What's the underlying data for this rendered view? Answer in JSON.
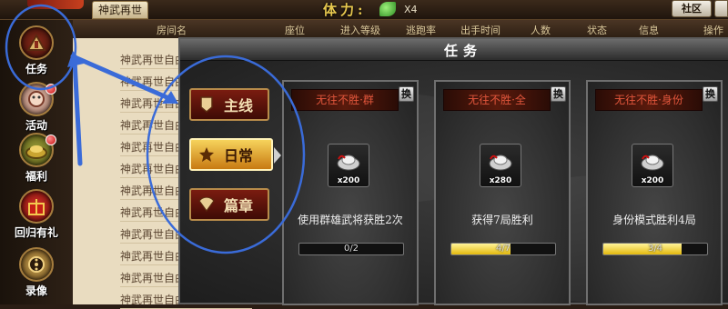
{
  "topbar": {
    "room_tab": "神武再世",
    "stamina_label": "体力:",
    "stamina_count": "X4",
    "community": "社区"
  },
  "sidebar": {
    "items": [
      {
        "label": "任务",
        "icon": "task-icon",
        "badge": false
      },
      {
        "label": "活动",
        "icon": "activity-icon",
        "badge": true
      },
      {
        "label": "福利",
        "icon": "welfare-icon",
        "badge": true
      },
      {
        "label": "回归有礼",
        "icon": "gift-icon",
        "badge": false
      },
      {
        "label": "录像",
        "icon": "replay-icon",
        "badge": false
      }
    ]
  },
  "room_list": {
    "columns": [
      "房间名",
      "座位",
      "进入等级",
      "逃跑率",
      "出手时间",
      "人数",
      "状态",
      "信息",
      "操作"
    ],
    "rows": [
      "神武再世自由",
      "神武再世自由",
      "神武再世自由",
      "神武再世自由",
      "神武再世自由",
      "神武再世自由",
      "神武再世自由",
      "神武再世自由",
      "神武再世自由",
      "神武再世自由",
      "神武再世自由",
      "神武再世自由",
      "神武再世自由"
    ]
  },
  "panel": {
    "title": "任务",
    "tabs": [
      {
        "label": "主线",
        "icon": "banner-icon",
        "active": false
      },
      {
        "label": "日常",
        "icon": "star-icon",
        "active": true
      },
      {
        "label": "篇章",
        "icon": "fan-icon",
        "active": false
      }
    ],
    "cards": [
      {
        "header": "无往不胜·群",
        "swap": "换",
        "reward": "x200",
        "desc": "使用群雄武将获胜2次",
        "progress_text": "0/2",
        "progress": 0.0
      },
      {
        "header": "无往不胜·全",
        "swap": "换",
        "reward": "x280",
        "desc": "获得7局胜利",
        "progress_text": "4/7",
        "progress": 0.571
      },
      {
        "header": "无往不胜·身份",
        "swap": "换",
        "reward": "x200",
        "desc": "身份模式胜利4局",
        "progress_text": "3/4",
        "progress": 0.75
      }
    ]
  },
  "colors": {
    "progress_fill": "#e3b90d",
    "card_header_text": "#e2563c",
    "annotation": "#3a6bd8"
  }
}
